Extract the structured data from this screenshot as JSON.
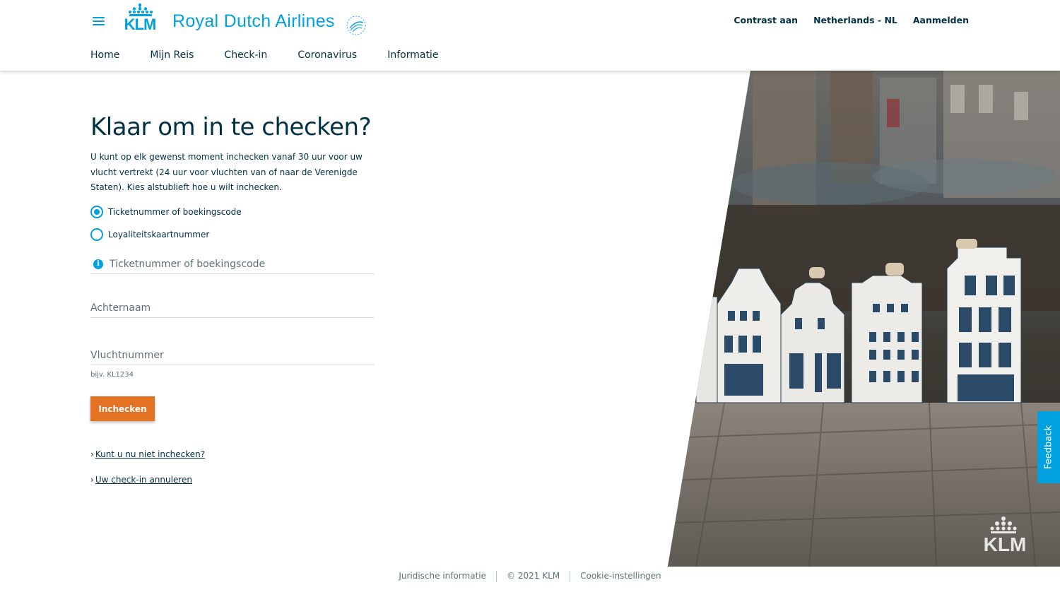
{
  "brand": {
    "name": "Royal Dutch Airlines",
    "logo_text": "KLM",
    "alliance_badge": "SKYTEAM",
    "color": "#00a1de"
  },
  "top_links": [
    "Contrast aan",
    "Netherlands - NL",
    "Aanmelden"
  ],
  "nav": [
    "Home",
    "Mijn Reis",
    "Check-in",
    "Coronavirus",
    "Informatie"
  ],
  "main": {
    "title": "Klaar om in te checken?",
    "intro": "U kunt op elk gewenst moment inchecken vanaf 30 uur voor uw vlucht vertrekt (24 uur voor vluchten van of naar de Verenigde Staten). Kies alstublieft hoe u wilt inchecken.",
    "options": [
      {
        "label": "Ticketnummer of boekingscode",
        "selected": true
      },
      {
        "label": "Loyaliteitskaartnummer",
        "selected": false
      }
    ],
    "fields": {
      "ticket": {
        "placeholder": "Ticketnummer of boekingscode",
        "value": ""
      },
      "lastname": {
        "placeholder": "Achternaam",
        "value": ""
      },
      "flight": {
        "placeholder": "Vluchtnummer",
        "value": "",
        "hint": "bijv. KL1234"
      }
    },
    "submit_label": "Inchecken",
    "links": [
      "Kunt u nu niet inchecken?",
      "Uw check-in annuleren"
    ]
  },
  "image": {
    "watermark": "KLM"
  },
  "feedback_label": "Feedback",
  "footer": [
    "Juridische informatie",
    "© 2021 KLM",
    "Cookie-instellingen"
  ],
  "colors": {
    "accent": "#00a1de",
    "cta": "#e37222",
    "text": "#003145"
  }
}
